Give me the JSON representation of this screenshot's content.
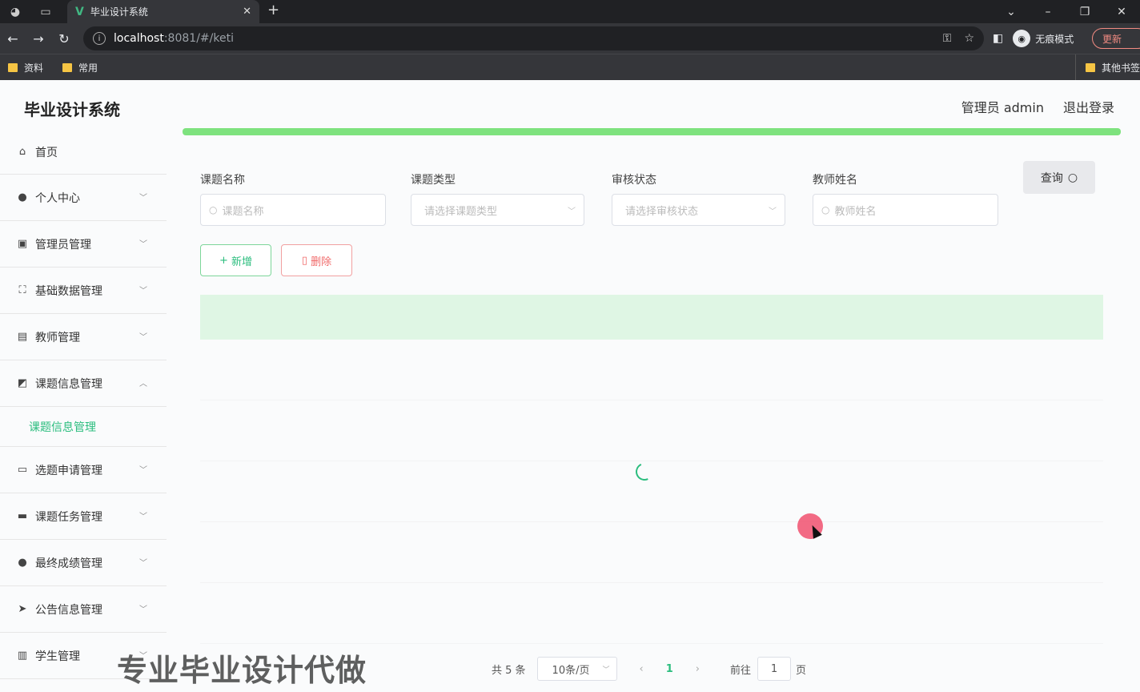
{
  "browser": {
    "tab_title": "毕业设计系统",
    "url_host": "localhost",
    "url_path": ":8081/#/keti",
    "incognito_label": "无痕模式",
    "update_label": "更新",
    "bookmarks": [
      "资料",
      "常用"
    ],
    "other_bookmarks": "其他书签"
  },
  "header": {
    "brand": "毕业设计系统",
    "user": "管理员 admin",
    "logout": "退出登录"
  },
  "sidebar": {
    "items": [
      {
        "label": "首页",
        "icon": "home-icon"
      },
      {
        "label": "个人中心",
        "icon": "user-icon"
      },
      {
        "label": "管理员管理",
        "icon": "clipboard-icon"
      },
      {
        "label": "基础数据管理",
        "icon": "frame-icon"
      },
      {
        "label": "教师管理",
        "icon": "id-card-icon"
      },
      {
        "label": "课题信息管理",
        "icon": "chart-icon"
      },
      {
        "label": "选题申请管理",
        "icon": "chat-icon"
      },
      {
        "label": "课题任务管理",
        "icon": "monitor-icon"
      },
      {
        "label": "最终成绩管理",
        "icon": "bulb-icon"
      },
      {
        "label": "公告信息管理",
        "icon": "send-icon"
      },
      {
        "label": "学生管理",
        "icon": "bars-icon"
      }
    ],
    "active_sub": "课题信息管理"
  },
  "search": {
    "title_label": "课题名称",
    "title_placeholder": "课题名称",
    "type_label": "课题类型",
    "type_placeholder": "请选择课题类型",
    "status_label": "审核状态",
    "status_placeholder": "请选择审核状态",
    "teacher_label": "教师姓名",
    "teacher_placeholder": "教师姓名",
    "query_button": "查询"
  },
  "actions": {
    "add": "新增",
    "delete": "删除"
  },
  "pagination": {
    "total": "共 5 条",
    "page_size": "10条/页",
    "current_page": "1",
    "goto_label": "前往",
    "goto_value": "1",
    "page_suffix": "页"
  },
  "overlay": {
    "watermark": "专业毕业设计代做"
  },
  "colors": {
    "accent": "#2bbd7e",
    "progress": "#7ee27e",
    "danger": "#f06a6a"
  }
}
